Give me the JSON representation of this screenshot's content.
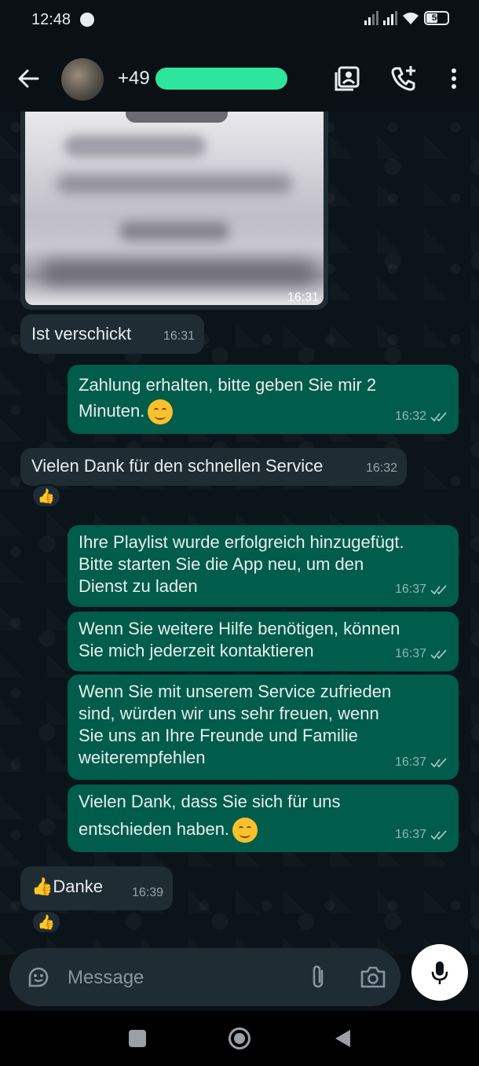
{
  "status_bar": {
    "time": "12:48",
    "battery": "50",
    "battery_level": 0.5
  },
  "header": {
    "contact_name": "+49",
    "icons": [
      "back-arrow-icon",
      "contact-card-icon",
      "add-call-icon",
      "more-vert-icon"
    ]
  },
  "messages": [
    {
      "type": "image",
      "direction": "in",
      "time": "16:31"
    },
    {
      "direction": "in",
      "text": "Ist verschickt",
      "time": "16:31"
    },
    {
      "direction": "out",
      "lines": [
        "Zahlung erhalten, bitte geben Sie mir 2",
        "Minuten."
      ],
      "emoji": "😊",
      "time": "16:32",
      "read": true
    },
    {
      "direction": "in",
      "text": "Vielen Dank für den schnellen Service",
      "time": "16:32",
      "reaction": "👍"
    },
    {
      "direction": "out",
      "lines": [
        "Ihre Playlist wurde erfolgreich hinzugefügt.",
        "Bitte starten Sie die App neu, um den",
        "Dienst zu laden"
      ],
      "time": "16:37",
      "read": true
    },
    {
      "direction": "out",
      "lines": [
        "Wenn Sie weitere Hilfe benötigen, können",
        "Sie mich jederzeit kontaktieren"
      ],
      "time": "16:37",
      "read": true
    },
    {
      "direction": "out",
      "lines": [
        "Wenn Sie mit unserem Service zufrieden",
        "sind, würden wir uns sehr freuen, wenn",
        "Sie uns an Ihre Freunde und Familie",
        "weiterempfehlen"
      ],
      "time": "16:37",
      "read": true
    },
    {
      "direction": "out",
      "lines": [
        "Vielen Dank, dass Sie sich für uns",
        "entschieden haben."
      ],
      "emoji": "😊",
      "time": "16:37",
      "read": true
    },
    {
      "direction": "in",
      "text": "👍Danke",
      "time": "16:39",
      "reaction": "👍"
    }
  ],
  "composer": {
    "placeholder": "Message"
  },
  "colors": {
    "incoming_bubble": "#1f2c34",
    "outgoing_bubble": "#005c4b",
    "background": "#0b141a",
    "redaction": "#2ee59e"
  }
}
